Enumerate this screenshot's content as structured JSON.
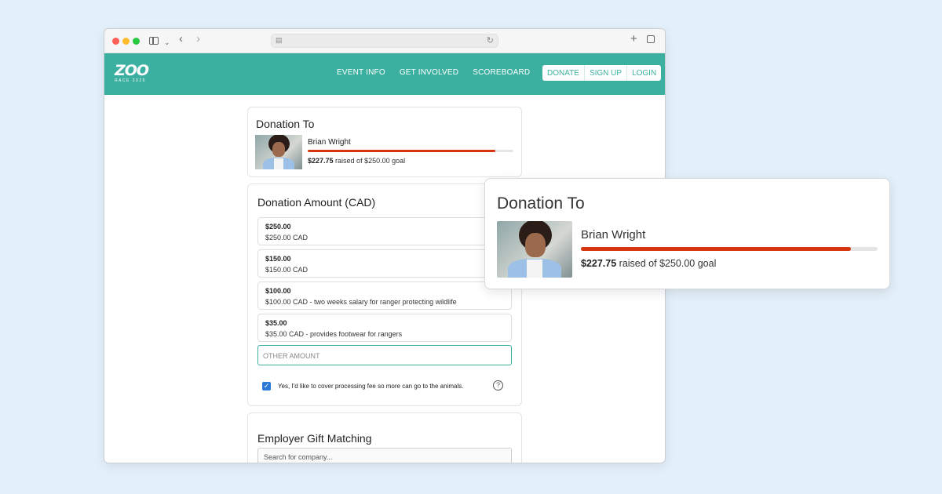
{
  "nav": {
    "logo_main": "ZOO",
    "logo_sub": "RACE 2025",
    "links": [
      "EVENT INFO",
      "GET INVOLVED",
      "SCOREBOARD"
    ],
    "auth": [
      "DONATE",
      "SIGN UP",
      "LOGIN"
    ]
  },
  "donation_to": {
    "title": "Donation To",
    "name": "Brian Wright",
    "raised_amount": "$227.75",
    "raised_text": " raised of $250.00 goal",
    "progress": 0.911
  },
  "amount": {
    "title": "Donation Amount (CAD)",
    "options": [
      {
        "amount": "$250.00",
        "desc": "$250.00 CAD"
      },
      {
        "amount": "$150.00",
        "desc": "$150.00 CAD"
      },
      {
        "amount": "$100.00",
        "desc": "$100.00 CAD - two weeks salary for ranger protecting wildlife"
      },
      {
        "amount": "$35.00",
        "desc": "$35.00 CAD - provides footwear for rangers"
      }
    ],
    "other_placeholder": "OTHER AMOUNT",
    "fee_label": "Yes, I'd like to cover processing fee so more can go to the animals.",
    "fee_checked": true
  },
  "employer": {
    "title": "Employer Gift Matching",
    "search_placeholder": "Search for company..."
  },
  "colors": {
    "brand": "#3cb0a0",
    "progress": "#d5350f",
    "checkbox": "#2b77d6"
  }
}
